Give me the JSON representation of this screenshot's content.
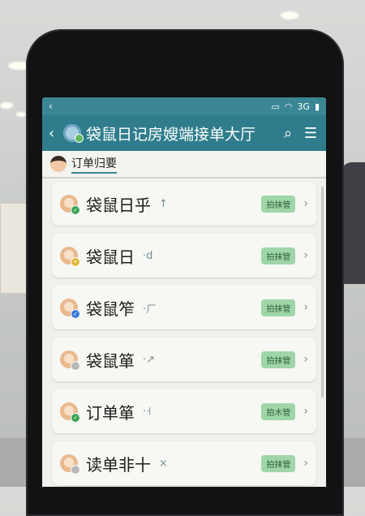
{
  "status_bar": {
    "battery_text": "3G"
  },
  "nav": {
    "title": "袋鼠日记房嫂端接单大厅",
    "back_icon": "chevron-left-icon",
    "search_icon": "search-icon",
    "menu_icon": "hamburger-menu-icon"
  },
  "section": {
    "title": "订单归要"
  },
  "orders": [
    {
      "name": "袋鼠日乎",
      "mark": "↑",
      "action": "拍抹管",
      "status": "green"
    },
    {
      "name": "袋鼠日",
      "mark": "·d",
      "action": "拍抹管",
      "status": "yellow"
    },
    {
      "name": "袋鼠笮",
      "mark": "·ㄏ",
      "action": "拍抹管",
      "status": "blue"
    },
    {
      "name": "袋鼠箪",
      "mark": "·↗",
      "action": "拍抹管",
      "status": "gray"
    },
    {
      "name": "订单箪",
      "mark": "·˧",
      "action": "拍木管",
      "status": "green"
    },
    {
      "name": "读单非十",
      "mark": "×",
      "action": "拍抹管",
      "status": "gray"
    }
  ],
  "colors": {
    "header": "#2f7d8c",
    "action_badge": "#9fd6a9",
    "status_green": "#3aa455",
    "status_yellow": "#e2b93b",
    "status_blue": "#3b7bd6",
    "status_gray": "#b8b8b8"
  }
}
